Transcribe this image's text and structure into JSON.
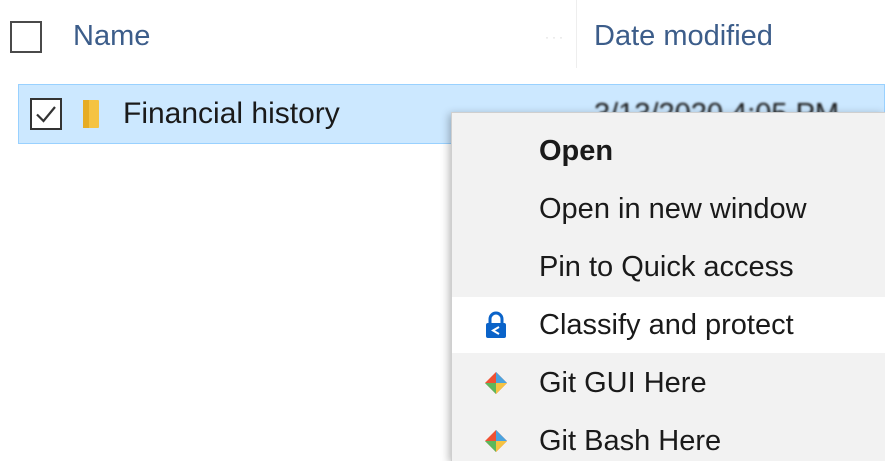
{
  "header": {
    "name_label": "Name",
    "date_label": "Date modified"
  },
  "file_row": {
    "name": "Financial history",
    "date": "3/13/2020 4:05 PM",
    "selected": true,
    "checked": true
  },
  "context_menu": {
    "items": [
      {
        "label": "Open",
        "bold": true,
        "icon": null
      },
      {
        "label": "Open in new window",
        "bold": false,
        "icon": null
      },
      {
        "label": "Pin to Quick access",
        "bold": false,
        "icon": null
      },
      {
        "label": "Classify and protect",
        "bold": false,
        "icon": "lock-icon",
        "hovered": true
      },
      {
        "label": "Git GUI Here",
        "bold": false,
        "icon": "git-icon"
      },
      {
        "label": "Git Bash Here",
        "bold": false,
        "icon": "git-icon"
      }
    ]
  },
  "colors": {
    "header_text": "#3c5d8a",
    "selection_bg": "#cce8ff",
    "selection_border": "#99d1ff",
    "menu_bg": "#f2f2f2",
    "lock_icon": "#0a63c9",
    "folder": "#f5c342"
  }
}
